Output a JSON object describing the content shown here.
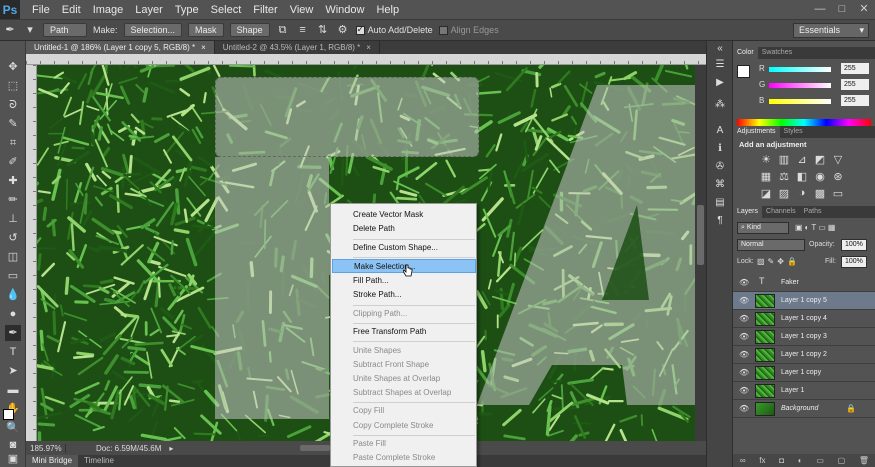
{
  "app": {
    "logo": "Ps"
  },
  "menubar": {
    "items": [
      "File",
      "Edit",
      "Image",
      "Layer",
      "Type",
      "Select",
      "Filter",
      "View",
      "Window",
      "Help"
    ]
  },
  "window_controls": {
    "minimize": "—",
    "maximize": "□",
    "close": "✕"
  },
  "options": {
    "mode": "Path",
    "make_label": "Make:",
    "selection_btn": "Selection...",
    "mask_btn": "Mask",
    "shape_btn": "Shape",
    "auto_add_delete": "Auto Add/Delete",
    "align_edges": "Align Edges",
    "workspace": "Essentials"
  },
  "doc_tabs": [
    {
      "label": "Untitled-1 @ 186% (Layer 1 copy 5, RGB/8) *",
      "close": "×",
      "active": true
    },
    {
      "label": "Untitled-2 @ 43.5% (Layer 1, RGB/8) *",
      "close": "×",
      "active": false
    }
  ],
  "status": {
    "zoom": "185.97%",
    "doc": "Doc: 6.59M/45.6M"
  },
  "bottom_tabs": [
    "Mini Bridge",
    "Timeline"
  ],
  "context_menu": {
    "items": [
      {
        "label": "Create Vector Mask",
        "disabled": false
      },
      {
        "label": "Delete Path",
        "disabled": false
      },
      {
        "label": "Define Custom Shape...",
        "disabled": false
      },
      {
        "label": "Make Selection...",
        "disabled": false,
        "highlight": true
      },
      {
        "label": "Fill Path...",
        "disabled": false
      },
      {
        "label": "Stroke Path...",
        "disabled": false
      },
      {
        "label": "Clipping Path...",
        "disabled": true
      },
      {
        "label": "Free Transform Path",
        "disabled": false
      },
      {
        "label": "Unite Shapes",
        "disabled": true
      },
      {
        "label": "Subtract Front Shape",
        "disabled": true
      },
      {
        "label": "Unite Shapes at Overlap",
        "disabled": true
      },
      {
        "label": "Subtract Shapes at Overlap",
        "disabled": true
      },
      {
        "label": "Copy Fill",
        "disabled": true
      },
      {
        "label": "Copy Complete Stroke",
        "disabled": true
      },
      {
        "label": "Paste Fill",
        "disabled": true
      },
      {
        "label": "Paste Complete Stroke",
        "disabled": true
      }
    ]
  },
  "color_panel": {
    "tabs": [
      "Color",
      "Swatches"
    ],
    "channels": [
      {
        "label": "R",
        "value": "255",
        "gradient": "linear-gradient(90deg,#0ff,#fff)"
      },
      {
        "label": "G",
        "value": "255",
        "gradient": "linear-gradient(90deg,#f0f,#fff)"
      },
      {
        "label": "B",
        "value": "255",
        "gradient": "linear-gradient(90deg,#ff0,#fff)"
      }
    ]
  },
  "adjustments_panel": {
    "tabs": [
      "Adjustments",
      "Styles"
    ],
    "title": "Add an adjustment"
  },
  "layers_panel": {
    "tabs": [
      "Layers",
      "Channels",
      "Paths"
    ],
    "kind": "Kind",
    "blend": "Normal",
    "opacity_label": "Opacity:",
    "opacity": "100%",
    "lock_label": "Lock:",
    "fill_label": "Fill:",
    "fill": "100%",
    "layers": [
      {
        "name": "Faker",
        "type": "text",
        "selected": false
      },
      {
        "name": "Layer 1 copy 5",
        "type": "image",
        "selected": true
      },
      {
        "name": "Layer 1 copy 4",
        "type": "image",
        "selected": false
      },
      {
        "name": "Layer 1 copy 3",
        "type": "image",
        "selected": false
      },
      {
        "name": "Layer 1 copy 2",
        "type": "image",
        "selected": false
      },
      {
        "name": "Layer 1 copy",
        "type": "image",
        "selected": false
      },
      {
        "name": "Layer 1",
        "type": "image",
        "selected": false
      },
      {
        "name": "Background",
        "type": "image",
        "selected": false,
        "locked": true
      }
    ]
  }
}
